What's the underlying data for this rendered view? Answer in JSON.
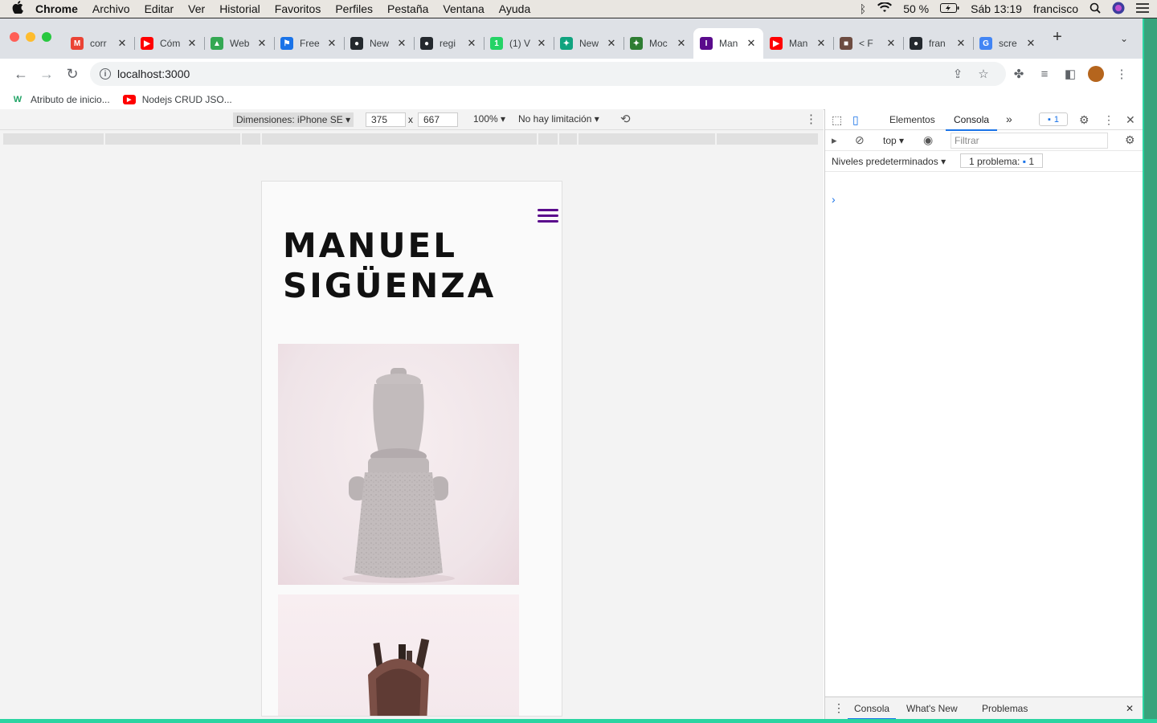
{
  "menubar": {
    "apple": "",
    "items": [
      "Chrome",
      "Archivo",
      "Editar",
      "Ver",
      "Historial",
      "Favoritos",
      "Perfiles",
      "Pestaña",
      "Ventana",
      "Ayuda"
    ],
    "battery": "50 %",
    "clock": "Sáb 13:19",
    "user": "francisco"
  },
  "tabs": [
    {
      "title": "corr",
      "fav": "M",
      "color": "#ea4335"
    },
    {
      "title": "Cóm",
      "fav": "▶",
      "color": "#ff0000"
    },
    {
      "title": "Web",
      "fav": "▲",
      "color": "#34a853"
    },
    {
      "title": "Free",
      "fav": "⚑",
      "color": "#1a73e8"
    },
    {
      "title": "New",
      "fav": "●",
      "color": "#24292e"
    },
    {
      "title": "regi",
      "fav": "●",
      "color": "#24292e"
    },
    {
      "title": "(1) V",
      "fav": "1",
      "color": "#25d366"
    },
    {
      "title": "New",
      "fav": "✦",
      "color": "#10a37f"
    },
    {
      "title": "Moc",
      "fav": "✦",
      "color": "#2e7d32"
    },
    {
      "title": "Man",
      "fav": "I",
      "color": "#5a0b8c",
      "active": true
    },
    {
      "title": "Man",
      "fav": "▶",
      "color": "#ff0000"
    },
    {
      "title": "< F",
      "fav": "■",
      "color": "#6d4c41"
    },
    {
      "title": "fran",
      "fav": "●",
      "color": "#24292e"
    },
    {
      "title": "scre",
      "fav": "G",
      "color": "#4285f4"
    }
  ],
  "new_tab_label": "+",
  "tab_menu_label": "⌄",
  "address": {
    "url": "localhost:3000"
  },
  "bookmarks": [
    {
      "label": "Atributo de inicio...",
      "icon": "W",
      "color": "#21a366"
    },
    {
      "label": "Nodejs CRUD JSO...",
      "icon": "▶",
      "color": "#ff0000"
    }
  ],
  "device_toolbar": {
    "dimensions": "Dimensiones: iPhone SE ▾",
    "width": "375",
    "height": "667",
    "times": "x",
    "zoom": "100% ▾",
    "throttle": "No hay limitación ▾"
  },
  "site": {
    "title_line1": "MANUEL",
    "title_line2": "SIGÜENZA"
  },
  "devtools": {
    "tab_elements": "Elementos",
    "tab_console": "Consola",
    "more": "»",
    "badge_count": "1",
    "context": "top ▾",
    "filter_placeholder": "Filtrar",
    "levels": "Niveles predeterminados ▾",
    "problems": "1 problema:",
    "problems_count": "1",
    "prompt": "›",
    "drawer_console": "Consola",
    "drawer_whatsnew": "What's New",
    "drawer_problems": "Problemas"
  }
}
